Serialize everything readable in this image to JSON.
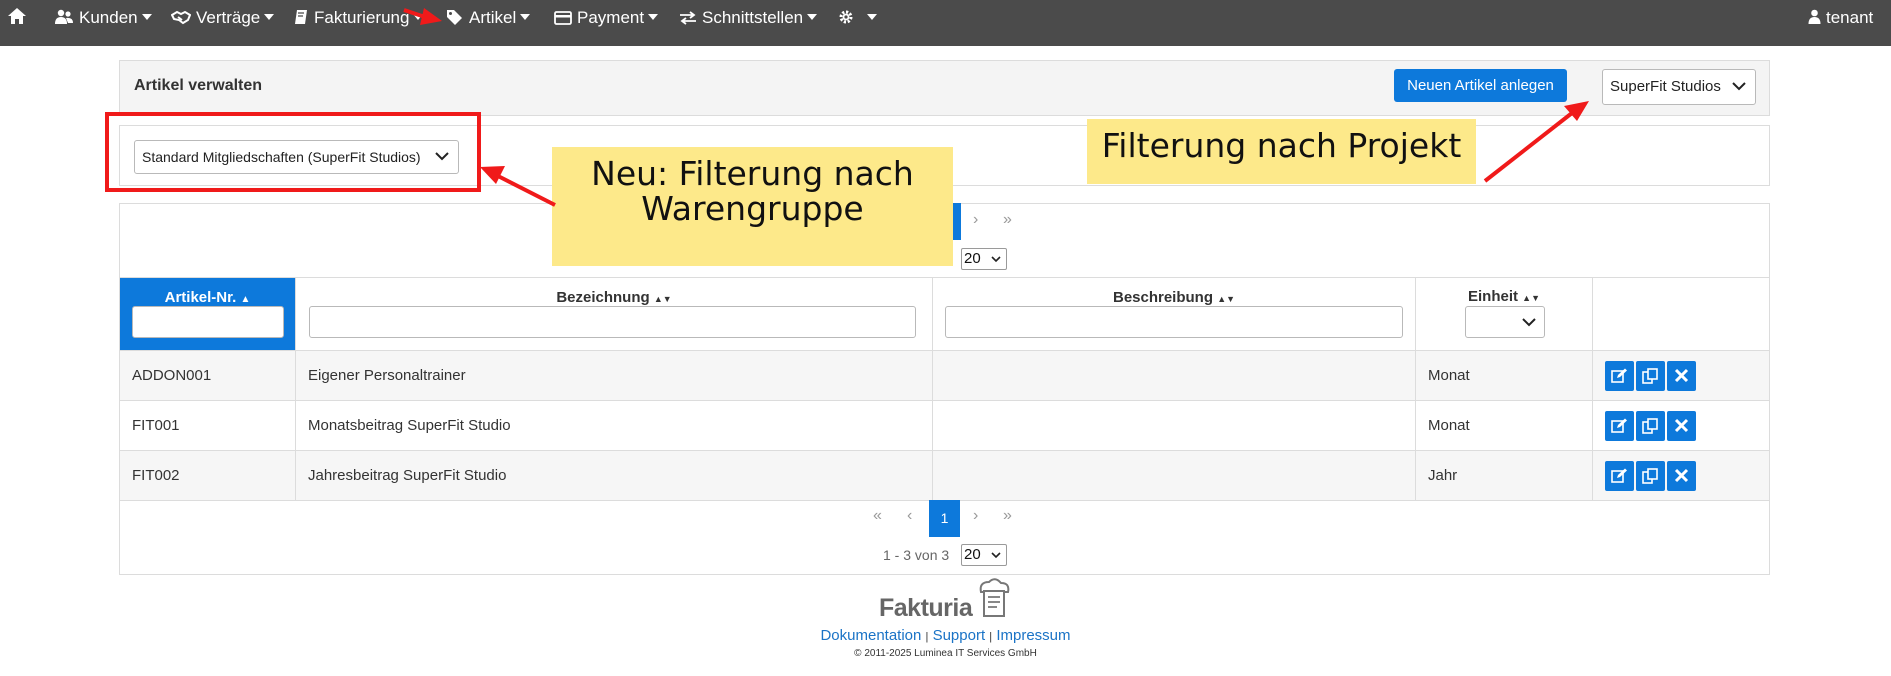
{
  "nav": {
    "items": [
      {
        "label": "Kunden",
        "icon": "users-icon"
      },
      {
        "label": "Verträge",
        "icon": "handshake-icon"
      },
      {
        "label": "Fakturierung",
        "icon": "book-icon"
      },
      {
        "label": "Artikel",
        "icon": "tags-icon"
      },
      {
        "label": "Payment",
        "icon": "credit-card-icon"
      },
      {
        "label": "Schnittstellen",
        "icon": "exchange-icon"
      }
    ],
    "user": "tenant"
  },
  "header": {
    "title": "Artikel verwalten",
    "new_button": "Neuen Artikel anlegen",
    "project_select": "SuperFit Studios"
  },
  "filter": {
    "group_select": "Standard Mitgliedschaften (SuperFit Studios)"
  },
  "pagination_top": {
    "page_size": "20"
  },
  "table": {
    "columns": {
      "nr": "Artikel-Nr.",
      "bez": "Bezeichnung",
      "desc": "Beschreibung",
      "unit": "Einheit"
    },
    "rows": [
      {
        "nr": "ADDON001",
        "bez": "Eigener Personaltrainer",
        "desc": "",
        "unit": "Monat"
      },
      {
        "nr": "FIT001",
        "bez": "Monatsbeitrag SuperFit Studio",
        "desc": "",
        "unit": "Monat"
      },
      {
        "nr": "FIT002",
        "bez": "Jahresbeitrag SuperFit Studio",
        "desc": "",
        "unit": "Jahr"
      }
    ]
  },
  "pagination_bottom": {
    "current_page": "1",
    "range_text": "1 - 3 von 3",
    "page_size": "20"
  },
  "annotations": {
    "warengruppe_line1": "Neu: Filterung nach",
    "warengruppe_line2": "Warengruppe",
    "projekt": "Filterung nach Projekt"
  },
  "footer": {
    "logo": "Fakturia",
    "links": [
      "Dokumentation",
      "Support",
      "Impressum"
    ],
    "copyright": "© 2011-2025 Luminea IT Services GmbH"
  },
  "colors": {
    "navbar": "#4b4b4b",
    "accent": "#0d79db",
    "annotation_red": "#f01a1a",
    "note_yellow": "#fde98a"
  }
}
